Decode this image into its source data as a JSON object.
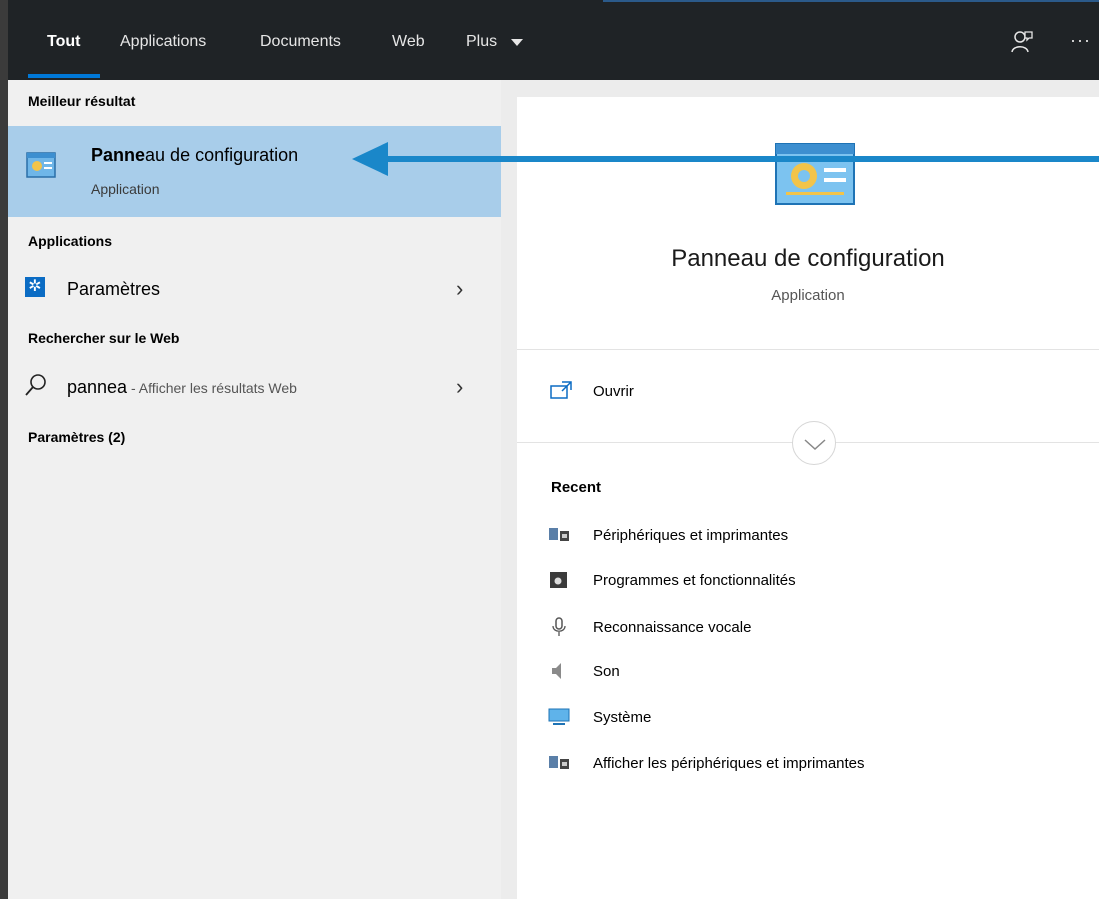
{
  "tabs": [
    {
      "label": "Tout",
      "active": true
    },
    {
      "label": "Applications"
    },
    {
      "label": "Documents"
    },
    {
      "label": "Web"
    },
    {
      "label": "Plus"
    }
  ],
  "toolbar": {
    "more_label": "···",
    "feedback_icon": "feedback-icon"
  },
  "left": {
    "best_header": "Meilleur résultat",
    "best": {
      "title_bold": "Panne",
      "title_rest": "au de configuration",
      "subtitle": "Application",
      "icon": "control-panel-icon"
    },
    "apps_header": "Applications",
    "apps": [
      {
        "label": "Paramètres",
        "icon": "gear-icon"
      }
    ],
    "web_header": "Rechercher sur le Web",
    "web": {
      "query": "pannea",
      "suffix": " - Afficher les résultats Web",
      "icon": "search-icon"
    },
    "settings_header": "Paramètres (2)"
  },
  "preview": {
    "title": "Panneau de configuration",
    "subtitle": "Application",
    "open_label": "Ouvrir",
    "recent_header": "Recent",
    "recent": [
      {
        "label": "Périphériques et imprimantes",
        "icon": "devices-printers-icon"
      },
      {
        "label": "Programmes et fonctionnalités",
        "icon": "programs-icon"
      },
      {
        "label": "Reconnaissance vocale",
        "icon": "microphone-icon"
      },
      {
        "label": "Son",
        "icon": "speaker-icon"
      },
      {
        "label": "Système",
        "icon": "monitor-icon"
      },
      {
        "label": "Afficher les périphériques et imprimantes",
        "icon": "devices-printers-icon"
      }
    ]
  },
  "colors": {
    "accent": "#0078d7",
    "selection": "#a8cdea",
    "topbar": "#1f2326",
    "arrow": "#1a87c9"
  }
}
